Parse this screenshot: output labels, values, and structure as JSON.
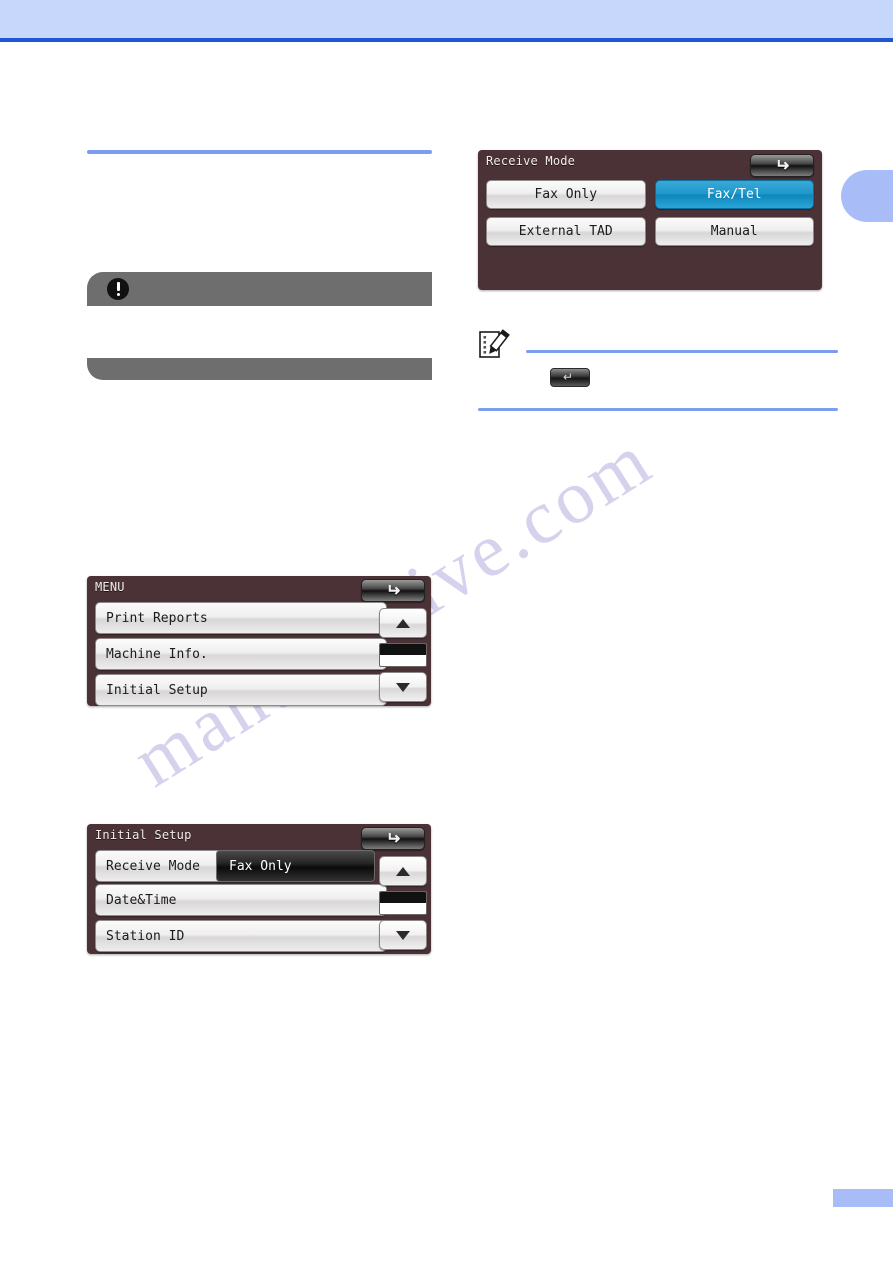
{
  "page": {
    "header_band_color": "#c7d7fb",
    "header_rule_color": "#1e56d6",
    "chapter_tab_color": "#a8bdf7",
    "watermark": "manualshive.com",
    "chapter_tab_label": "",
    "page_number": ""
  },
  "left_column": {
    "important_callout": {
      "icon": "exclamation-circle-icon",
      "title": "",
      "text": ""
    },
    "menu_screen": {
      "title": "MENU",
      "back_icon": "back-arrow-icon",
      "items": [
        {
          "label": "Print Reports"
        },
        {
          "label": "Machine Info."
        },
        {
          "label": "Initial Setup"
        }
      ],
      "scroll_up_icon": "triangle-up-icon",
      "scroll_down_icon": "triangle-down-icon",
      "scroll_indicator": "scroll-position-indicator"
    },
    "initial_setup_screen": {
      "title": "Initial Setup",
      "back_icon": "back-arrow-icon",
      "items": [
        {
          "label": "Receive Mode",
          "value": "Fax Only"
        },
        {
          "label": "Date&Time",
          "value": ""
        },
        {
          "label": "Station ID",
          "value": ""
        }
      ],
      "scroll_up_icon": "triangle-up-icon",
      "scroll_down_icon": "triangle-down-icon",
      "scroll_indicator": "scroll-position-indicator"
    }
  },
  "right_column": {
    "receive_mode_screen": {
      "title": "Receive Mode",
      "back_icon": "back-arrow-icon",
      "selected_color": "#1c97cb",
      "buttons": [
        {
          "label": "Fax Only",
          "selected": false
        },
        {
          "label": "Fax/Tel",
          "selected": true
        },
        {
          "label": "External TAD",
          "selected": false
        },
        {
          "label": "Manual",
          "selected": false
        }
      ]
    },
    "note_block": {
      "icon": "note-pencil-icon",
      "heading": "",
      "inline_key_icon": "back-arrow-key-icon",
      "text": ""
    }
  }
}
